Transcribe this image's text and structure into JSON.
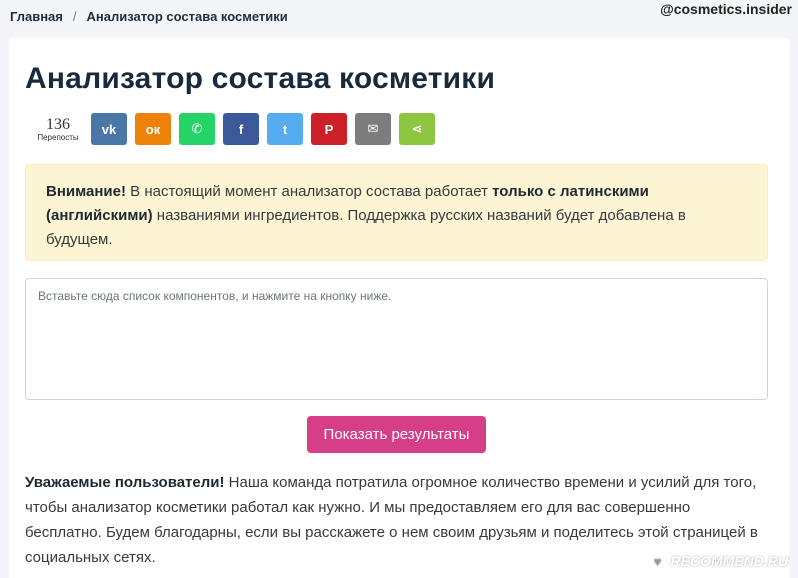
{
  "breadcrumb": {
    "home": "Главная",
    "separator": "/",
    "current": "Анализатор состава косметики"
  },
  "watermark_top": "@cosmetics.insider",
  "title": "Анализатор состава косметики",
  "share": {
    "count": "136",
    "count_label": "Перепосты",
    "buttons": [
      {
        "name": "vk",
        "icon": "vk-icon",
        "glyph": "vk",
        "color": "#4a76a8"
      },
      {
        "name": "odnoklassniki",
        "icon": "odnoklassniki-icon",
        "glyph": "ок",
        "color": "#ee8208"
      },
      {
        "name": "whatsapp",
        "icon": "whatsapp-icon",
        "glyph": "✆",
        "color": "#25d366"
      },
      {
        "name": "facebook",
        "icon": "facebook-icon",
        "glyph": "f",
        "color": "#3b5998"
      },
      {
        "name": "twitter",
        "icon": "twitter-icon",
        "glyph": "t",
        "color": "#55acee"
      },
      {
        "name": "pinterest",
        "icon": "pinterest-icon",
        "glyph": "P",
        "color": "#cb2027"
      },
      {
        "name": "email",
        "icon": "email-icon",
        "glyph": "✉",
        "color": "#7d7d7d"
      },
      {
        "name": "share",
        "icon": "share-icon",
        "glyph": "⋖",
        "color": "#8dc63f"
      }
    ]
  },
  "alert": {
    "strong_prefix": "Внимание!",
    "text_1": " В настоящий момент анализатор состава работает ",
    "strong_mid": "только с латинскими (английскими)",
    "text_2": " названиями ингредиентов. Поддержка русских названий будет добавлена в будущем."
  },
  "textarea": {
    "placeholder": "Вставьте сюда список компонентов, и нажмите на кнопку ниже."
  },
  "show_button": "Показать результаты",
  "info": {
    "strong": "Уважаемые пользователи!",
    "text": " Наша команда потратила огромное количество времени и усилий для того, чтобы анализатор косметики работал как нужно. И мы предоставляем его для вас совершенно бесплатно. Будем благодарны, если вы расскажете о нем своим друзьям и поделитесь этой страницей в социальных сетях."
  },
  "watermark_bottom": "RECOMMEND.RU"
}
